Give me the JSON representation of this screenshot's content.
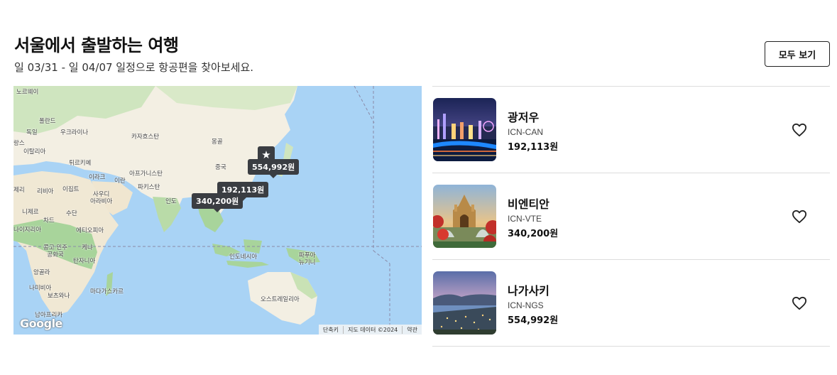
{
  "header": {
    "title": "서울에서 출발하는 여행",
    "subtitle": "일 03/31 - 일 04/07 일정으로 항공편을 찾아보세요.",
    "view_all_label": "모두 보기"
  },
  "map": {
    "pins": [
      {
        "price": "554,992원",
        "starred": true
      },
      {
        "price": "192,113원"
      },
      {
        "price": "340,200원"
      }
    ],
    "labels": {
      "norway": "노르웨이",
      "poland": "폴란드",
      "germany": "독일",
      "ukraine": "우크라이나",
      "spain": "랑스",
      "italy": "이탈리아",
      "turkey": "튀르키예",
      "kazakhstan": "카자흐스탄",
      "mongolia": "몽골",
      "iraq": "이라크",
      "iran": "이란",
      "afghanistan": "아프가니스탄",
      "china": "중국",
      "libya": "리비아",
      "egypt": "이집트",
      "saudi": "사우디\n아라비아",
      "pakistan": "파키스탄",
      "algeria": "제리",
      "india": "인도",
      "niger": "니제르",
      "chad": "차드",
      "sudan": "수단",
      "nigeria": "나이지리아",
      "ethiopia": "에티오피아",
      "kenya": "케냐",
      "drc": "콩고 민주\n공화국",
      "tanzania": "탄자니아",
      "angola": "앙골라",
      "indonesia": "인도네시아",
      "png": "파푸아\n뉴기니",
      "namibia": "나미비아",
      "botswana": "보츠와나",
      "madagascar": "마다가스카르",
      "australia": "오스트레일리아",
      "south_africa": "남아프리카"
    },
    "google_logo": "Google",
    "footer": {
      "shortcuts": "단축키",
      "map_data": "지도 데이터 ©2024",
      "terms": "약관"
    }
  },
  "destinations": [
    {
      "name": "광저우",
      "route": "ICN-CAN",
      "price": "192,113원",
      "thumb_icon": "guangzhou-photo"
    },
    {
      "name": "비엔티안",
      "route": "ICN-VTE",
      "price": "340,200원",
      "thumb_icon": "vientiane-photo"
    },
    {
      "name": "나가사키",
      "route": "ICN-NGS",
      "price": "554,992원",
      "thumb_icon": "nagasaki-photo"
    }
  ],
  "icons": {
    "favorite": "heart-icon",
    "pin_star": "★"
  },
  "colors": {
    "ocean": "#a9d3f5",
    "land": "#f3efe3",
    "green": "#a8d49b",
    "pin": "#3a3d42"
  }
}
